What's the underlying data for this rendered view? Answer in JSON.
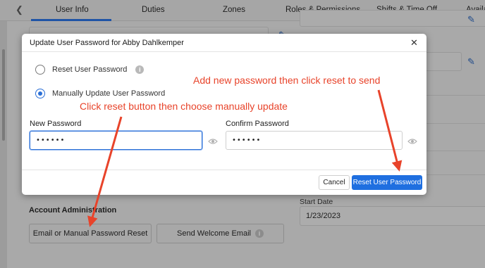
{
  "tabs": [
    {
      "label": "User Info"
    },
    {
      "label": "Duties"
    },
    {
      "label": "Zones"
    },
    {
      "label": "Roles & Permissions"
    },
    {
      "label": "Shifts & Time Off"
    },
    {
      "label": "Availa"
    }
  ],
  "background": {
    "partial_label": "N",
    "account_section_title": "Account Administration",
    "email_reset_button": "Email or Manual Password Reset",
    "welcome_email_button": "Send Welcome Email",
    "start_date_label": "Start Date",
    "start_date_value": "1/23/2023"
  },
  "modal": {
    "title": "Update User Password for Abby Dahlkemper",
    "options": [
      {
        "label": "Reset User Password",
        "selected": false
      },
      {
        "label": "Manually Update User Password",
        "selected": true
      }
    ],
    "new_password_label": "New Password",
    "new_password_value": "••••••",
    "confirm_password_label": "Confirm Password",
    "confirm_password_value": "••••••",
    "cancel_label": "Cancel",
    "reset_label": "Reset User Password"
  },
  "annotations": {
    "top_right": "Add new password then click reset to send",
    "middle_left": "Click reset button then choose manually update"
  },
  "colors": {
    "accent": "#1f6fe0",
    "annotation": "#e8432a",
    "overlay": "#a9a9a9"
  },
  "icons": {
    "close": "close-icon",
    "info": "info-icon",
    "eye": "eye-icon",
    "edit": "pencil-icon",
    "back": "chevron-left-icon"
  }
}
